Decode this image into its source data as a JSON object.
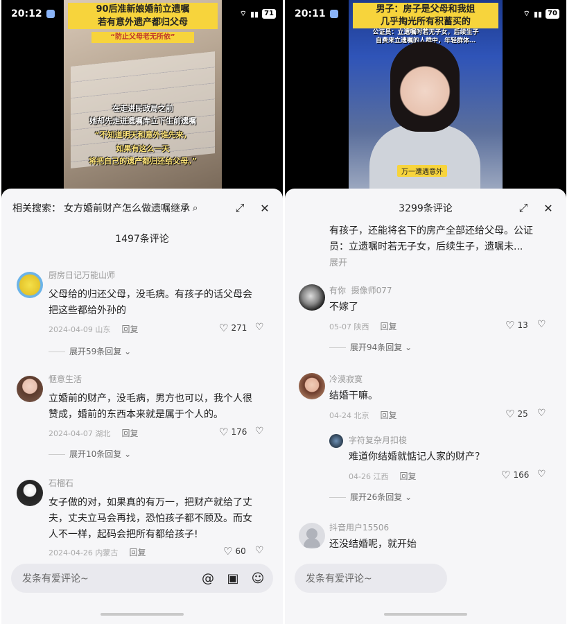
{
  "left": {
    "status": {
      "time": "20:12",
      "battery": "71"
    },
    "video": {
      "title_line1": "90后准新娘婚前立遗嘱",
      "title_line2": "若有意外遗产都归父母",
      "subtitle": "“防止父母老无所依”",
      "overlay1": "在走进民政局之前",
      "overlay2": "她却先走进遗嘱库立下生前遗嘱",
      "overlay3": "“不知道明天和意外谁先来，",
      "overlay4": "如果有这么一天",
      "overlay5": "将把自己的遗产都归还给父母。”"
    },
    "search": {
      "label": "相关搜索：",
      "query": "女方婚前财产怎么做遗嘱继承"
    },
    "count": "1497条评论",
    "comments": [
      {
        "user": "厨房日记万能山师",
        "text1": "父母给的归还父母，没毛病。有孩子的话父母会",
        "text2": "把这些都给外孙的",
        "date": "2024-04-09 山东",
        "reply": "回复",
        "likes": "271",
        "expand": "展开59条回复"
      },
      {
        "user": "惬意生活",
        "text1": "立婚前的财产，没毛病，男方也可以，我个人很",
        "text2": "赞成，婚前的东西本来就是属于个人的。",
        "date": "2024-04-07 湖北",
        "reply": "回复",
        "likes": "176",
        "expand": "展开10条回复"
      },
      {
        "user": "石榴石",
        "text1": "女子做的对，如果真的有万一，把财产就给了丈",
        "text2": "夫，丈夫立马会再找，恐怕孩子都不顾及。而女",
        "text3": "人不一样，起码会把所有都给孩子!",
        "date": "2024-04-26 内蒙古",
        "reply": "回复",
        "likes": "60"
      }
    ],
    "input_placeholder": "发条有爱评论~"
  },
  "right": {
    "status": {
      "time": "20:11",
      "battery": "70"
    },
    "video": {
      "title_line1": "男子：房子是父母和我姐",
      "title_line2": "几乎掏光所有积蓄买的",
      "sub1": "公证员：立遗嘱时若无子女，后续生子",
      "sub2": "自费来立遗嘱的人群中，年轻群体…",
      "tag": "万一遭遇意外"
    },
    "count": "3299条评论",
    "top_text1": "有孩子，还能将名下的房产全部还给父母。公证",
    "top_text2": "员：立遗嘱时若无子女，后续生子，遗嘱未...",
    "top_more": "展开",
    "comments": [
      {
        "user": "有你",
        "user2": "摄像师077",
        "text": "不嫁了",
        "date": "05-07 陕西",
        "reply": "回复",
        "likes": "13",
        "expand": "展开94条回复"
      },
      {
        "user": "冷漠寂寞",
        "text": "结婚干嘛。",
        "date": "04-24 北京",
        "reply": "回复",
        "likes": "25"
      },
      {
        "user": "字符复杂月扣梭",
        "text": "难道你结婚就惦记人家的财产？",
        "date": "04-26 江西",
        "reply": "回复",
        "likes": "166",
        "expand": "展开26条回复"
      },
      {
        "user": "抖音用户15506",
        "text": "还没结婚呢，就开始"
      }
    ],
    "input_placeholder": "发条有爱评论~"
  }
}
